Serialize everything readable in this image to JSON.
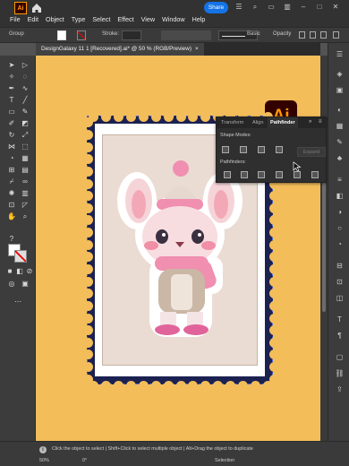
{
  "app": {
    "logo": "Ai"
  },
  "menu": [
    "File",
    "Edit",
    "Object",
    "Type",
    "Select",
    "Effect",
    "View",
    "Window",
    "Help"
  ],
  "toolbar": {
    "share_label": "Share",
    "selection_label": "Group",
    "stroke_label": "Stroke:",
    "brush_label": "Basic",
    "opacity_label": "Opacity"
  },
  "document": {
    "tab_title": "DesignGalaxy 11 1 [Recovered].ai* @ 50 % (RGB/Preview)",
    "close_icon": "×"
  },
  "badge": {
    "text": "Ai"
  },
  "pathfinder_panel": {
    "tabs": [
      "Transform",
      "Align",
      "Pathfinder"
    ],
    "active_tab": "Pathfinder",
    "shape_modes_label": "Shape Modes:",
    "pathfinders_label": "Pathfinders:",
    "expand_label": "Expand"
  },
  "status": {
    "hint": "Click the object to select  |  Shift+Click to select multiple object  |  Alt+Drag the object to duplicate",
    "zoom": "50%",
    "rotation": "0°",
    "mode": "Selection"
  },
  "colors": {
    "canvas": "#f3bd5a",
    "stamp_border": "#1b2150",
    "accent_share": "#1473e6",
    "ai_orange": "#ff9a00"
  }
}
